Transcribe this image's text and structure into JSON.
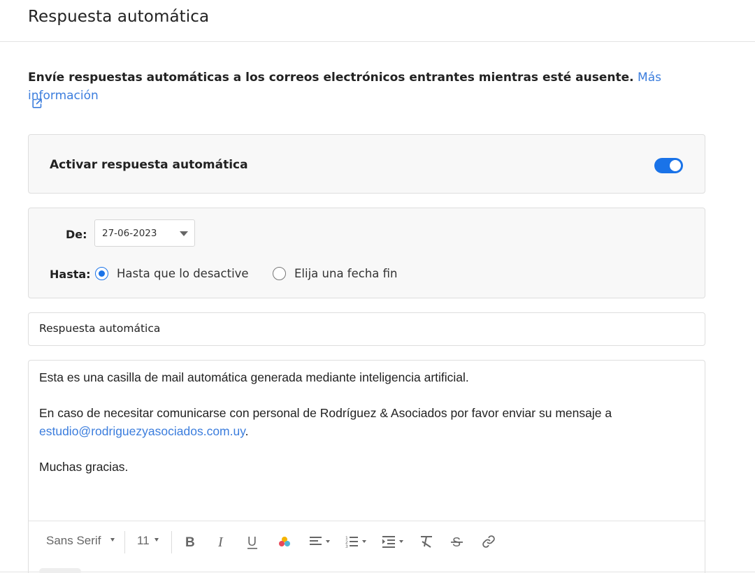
{
  "header": {
    "title": "Respuesta automática"
  },
  "intro": {
    "text": "Envíe respuestas automáticas a los correos electrónicos entrantes mientras esté ausente.",
    "link": "Más información",
    "external_icon": "external-link-icon"
  },
  "auto_reply": {
    "label": "Activar respuesta automática",
    "enabled": true,
    "accent_color": "#1a73e8"
  },
  "dates": {
    "from_label": "De:",
    "from_value": "27-06-2023",
    "until_label": "Hasta:",
    "options": [
      {
        "label": "Hasta que lo desactive",
        "selected": true
      },
      {
        "label": "Elija una fecha fin",
        "selected": false
      }
    ]
  },
  "subject": {
    "value": "Respuesta automática"
  },
  "message": {
    "line1": "Esta es una casilla de mail automática generada mediante inteligencia artificial.",
    "line2": "En caso de necesitar comunicarse con personal de Rodríguez & Asociados por favor enviar su mensaje a",
    "email": "estudio@rodriguezyasociados.com.uy",
    "email_suffix": ".",
    "line3": "Muchas gracias."
  },
  "toolbar": {
    "font": "Sans Serif",
    "size": "11",
    "icons": [
      "bold-icon",
      "italic-icon",
      "underline-icon",
      "color-icon",
      "align-icon",
      "numbered-list-icon",
      "indent-icon",
      "clear-format-icon",
      "strikethrough-icon",
      "link-icon"
    ]
  }
}
